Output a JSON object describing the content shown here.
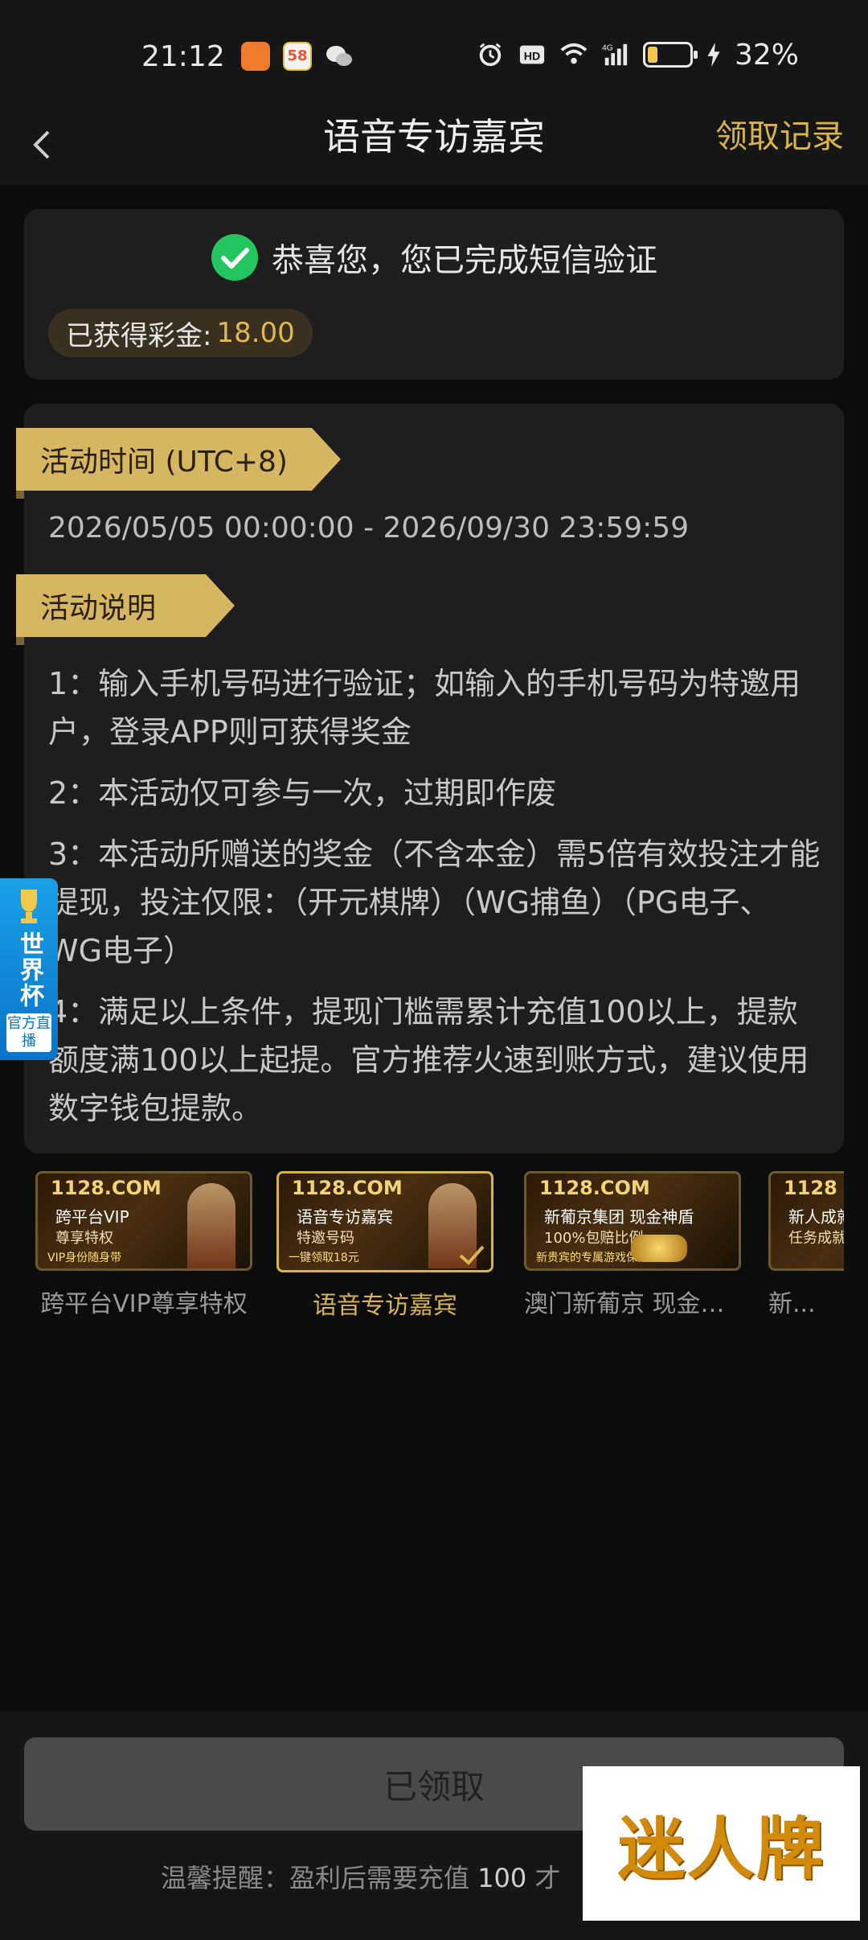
{
  "status_bar": {
    "time": "21:12",
    "battery_percent": "32%",
    "battery_level": 0.32,
    "icons": [
      "alarm-icon",
      "hd-icon",
      "wifi-icon",
      "signal-4g-icon",
      "battery-icon",
      "charging-icon"
    ]
  },
  "header": {
    "title": "语音专访嘉宾",
    "records_link": "领取记录"
  },
  "success": {
    "message": "恭喜您，您已完成短信验证",
    "bonus_label": "已获得彩金:",
    "bonus_value": "18.00"
  },
  "activity": {
    "time_label": "活动时间 (UTC+8)",
    "time_range": "2026/05/05 00:00:00 - 2026/09/30 23:59:59",
    "desc_label": "活动说明",
    "items": [
      "1：输入手机号码进行验证；如输入的手机号码为特邀用户，登录APP则可获得奖金",
      "2：本活动仅可参与一次，过期即作废",
      "3：本活动所赠送的奖金（不含本金）需5倍有效投注才能提现，投注仅限：（开元棋牌）（WG捕鱼）（PG电子、WG电子）",
      "4：满足以上条件，提现门槛需累计充值100以上，提款额度满100以上起提。官方推荐火速到账方式，建议使用数字钱包提款。"
    ]
  },
  "worldcup_badge": {
    "title": "世界杯",
    "subtitle": "官方直播"
  },
  "promos": [
    {
      "label": "跨平台VIP尊享特权",
      "logo": "1128.COM",
      "line1": "跨平台VIP",
      "line2": "尊享特权",
      "line3": "VIP身份随身带",
      "active": false
    },
    {
      "label": "语音专访嘉宾",
      "logo": "1128.COM",
      "line1": "语音专访嘉宾",
      "line2": "特邀号码",
      "line3": "一键领取18元",
      "active": true
    },
    {
      "label": "澳门新葡京 现金神...",
      "logo": "1128.COM",
      "line1": "新葡京集团 现金神盾",
      "line2": "100%包赔比例",
      "line3": "新贵宾的专属游戏保险",
      "active": false
    },
    {
      "label": "新...",
      "logo": "1128",
      "line1": "新人成就",
      "line2": "任务成就",
      "line3": "",
      "active": false
    }
  ],
  "bottom": {
    "button_label": "已领取",
    "tip_prefix": "温馨提醒：盈利后需要充值",
    "tip_number": "100",
    "tip_suffix": "才"
  },
  "watermark": "迷人牌",
  "colors": {
    "accent_gold": "#d9b44a",
    "ribbon": "#d7b661",
    "success_green": "#22c55e",
    "background": "#0c0c0c",
    "card": "#1e1e1e"
  }
}
